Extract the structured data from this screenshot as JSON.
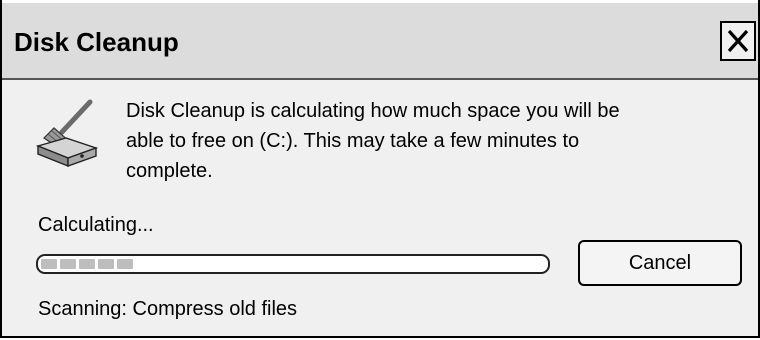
{
  "window": {
    "title": "Disk Cleanup"
  },
  "close_button": {
    "icon": "close-x-icon"
  },
  "dialog": {
    "icon": "disk-cleanup-broom-icon",
    "message_line1": "Disk Cleanup is calculating how much space you will be",
    "message_line2": "able to free on  (C:). This may take a few minutes to",
    "message_line3": "complete.",
    "calculating_label": "Calculating...",
    "progress_fraction": 0.2,
    "cancel_label": "Cancel",
    "scanning_label": "Scanning:",
    "scanning_item": "Compress old files"
  }
}
